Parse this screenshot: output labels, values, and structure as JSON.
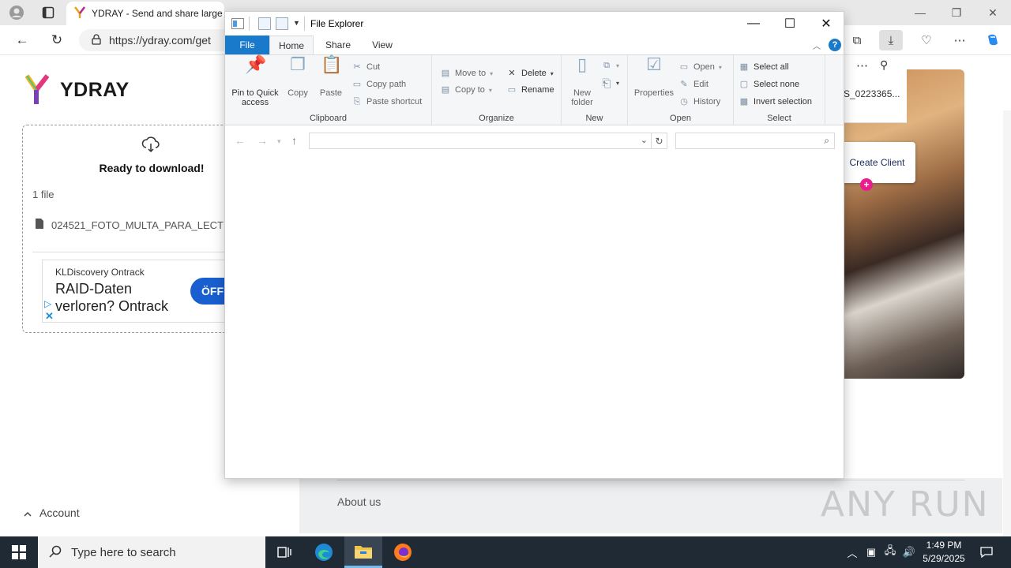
{
  "browser": {
    "tab_title": "YDRAY - Send and share large a",
    "url": "https://ydray.com/get",
    "download_file_name": "S_0223365..."
  },
  "page": {
    "logo_text": "YDRAY",
    "ready_text": "Ready to download!",
    "file_count": "1 file",
    "file_name": "024521_FOTO_MULTA_PARA_LECT",
    "ad": {
      "brand": "KLDiscovery Ontrack",
      "headline_line1": "RAID-Daten",
      "headline_line2": "verloren? Ontrack",
      "button": "ÖFF"
    },
    "create_client": "Create Client",
    "account": "Account",
    "about_us": "About us",
    "watermark": "ANY RUN"
  },
  "explorer": {
    "title": "File Explorer",
    "tabs": {
      "file": "File",
      "home": "Home",
      "share": "Share",
      "view": "View"
    },
    "clipboard": {
      "pin_line1": "Pin to Quick",
      "pin_line2": "access",
      "copy": "Copy",
      "paste": "Paste",
      "cut": "Cut",
      "copy_path": "Copy path",
      "paste_shortcut": "Paste shortcut",
      "label": "Clipboard"
    },
    "organize": {
      "move_to": "Move to",
      "copy_to": "Copy to",
      "delete": "Delete",
      "rename": "Rename",
      "label": "Organize"
    },
    "new": {
      "new_folder_line1": "New",
      "new_folder_line2": "folder",
      "label": "New"
    },
    "open": {
      "properties": "Properties",
      "open": "Open",
      "edit": "Edit",
      "history": "History",
      "label": "Open"
    },
    "select": {
      "select_all": "Select all",
      "select_none": "Select none",
      "invert": "Invert selection",
      "label": "Select"
    },
    "address": "",
    "search_placeholder": ""
  },
  "taskbar": {
    "search_placeholder": "Type here to search",
    "time": "1:49 PM",
    "date": "5/29/2025"
  }
}
